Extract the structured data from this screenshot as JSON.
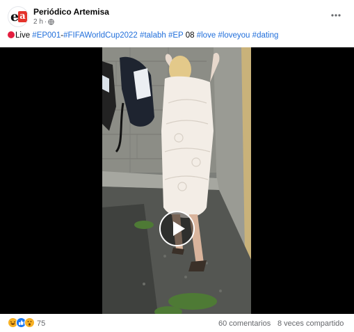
{
  "post": {
    "page_name": "Periódico Artemisa",
    "time": "2 h",
    "separator": " · ",
    "privacy_icon": "globe-icon",
    "more_icon": "more-options-icon",
    "caption": {
      "prefix": "Live ",
      "tags": [
        "#EP001",
        "#FIFAWorldCup2022",
        "#talabh",
        "#EP",
        "08",
        "#love",
        "#loveyou",
        "#dating"
      ]
    },
    "video": {
      "play_icon": "play-icon"
    },
    "footer": {
      "reaction_icons": [
        "haha-icon",
        "like-icon",
        "wow-icon"
      ],
      "reaction_count": "75",
      "comments": "60 comentarios",
      "shares": "8 veces compartido"
    }
  },
  "colors": {
    "link": "#216fdb",
    "live_dot": "#e41e3f",
    "secondary_text": "#65676b"
  }
}
